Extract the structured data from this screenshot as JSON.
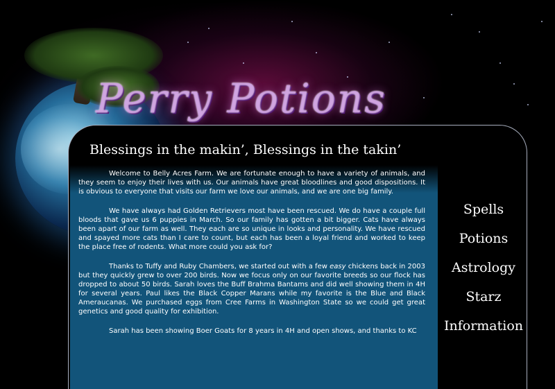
{
  "header": {
    "logo_text": "Perry Potions",
    "tagline": "Blessings in the makin’, Blessings in the takin’"
  },
  "nav": {
    "items": [
      {
        "label": "Spells"
      },
      {
        "label": "Potions"
      },
      {
        "label": "Astrology"
      },
      {
        "label": "Starz"
      },
      {
        "label": "Information"
      }
    ]
  },
  "main": {
    "paragraph1": "Welcome to Belly Acres Farm. We are fortunate enough to have a variety of animals, and they seem to enjoy their lives with us. Our animals have great bloodlines and good dispositions. It is obvious to everyone that visits our farm we love our animals, and we are one big family.",
    "paragraph2": "We have always had Golden Retrievers most have been rescued. We do have a couple full bloods that gave us 6 puppies in March. So our family has gotten a bit bigger. Cats have always been apart of our farm as well. They each are so unique in looks and personality. We have rescued and spayed more cats than I care to count, but each has been a loyal friend and worked to keep the place free of rodents. What more could you ask for?",
    "paragraph3_before": "Thanks to Tuffy and Ruby Chambers, we started out with a few ",
    "paragraph3_emphasis": "easy",
    "paragraph3_after": " chickens back in 2003 but they quickly grew to over 200 birds. Now we focus only on our favorite breeds so our flock has dropped to about 50 birds. Sarah loves the Buff Brahma Bantams and did well showing them in 4H for several years. Paul likes the Black Copper Marans while my favorite is the Blue and Black Ameraucanas. We purchased eggs from Cree Farms in Washington State so we could get great genetics and good quality for exhibition.",
    "paragraph4": "Sarah has been showing Boer Goats for 8 years in 4H and open shows, and thanks to KC"
  }
}
